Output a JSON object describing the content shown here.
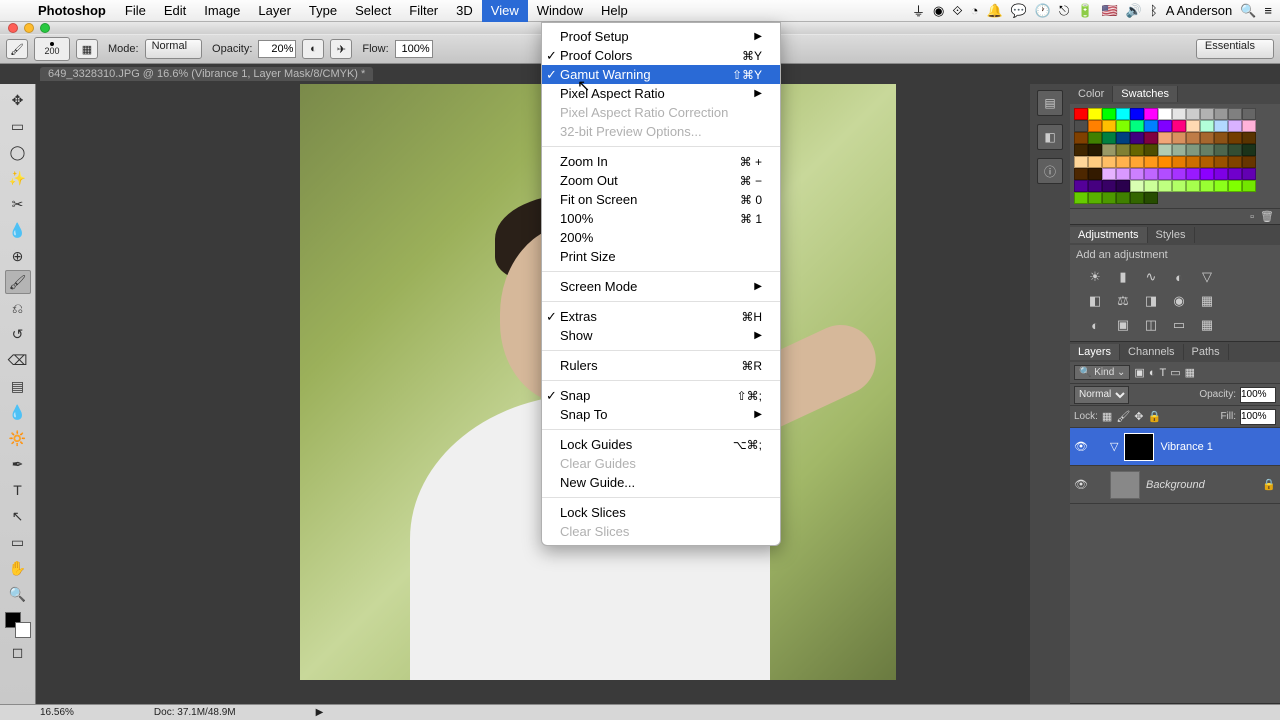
{
  "menubar": {
    "app": "Photoshop",
    "items": [
      "File",
      "Edit",
      "Image",
      "Layer",
      "Type",
      "Select",
      "Filter",
      "3D",
      "View",
      "Window",
      "Help"
    ],
    "active": "View",
    "user": "A Anderson"
  },
  "options": {
    "brush_size": "200",
    "mode_label": "Mode:",
    "mode_value": "Normal",
    "opacity_label": "Opacity:",
    "opacity_value": "20%",
    "flow_label": "Flow:",
    "flow_value": "100%",
    "workspace": "Essentials"
  },
  "document": {
    "tab_title": "649_3328310.JPG @ 16.6% (Vibrance 1, Layer Mask/8/CMYK) *"
  },
  "dropdown": {
    "items": [
      {
        "label": "Proof Setup",
        "submenu": true
      },
      {
        "label": "Proof Colors",
        "check": true,
        "shortcut": "⌘Y"
      },
      {
        "label": "Gamut Warning",
        "check": true,
        "shortcut": "⇧⌘Y",
        "highlight": true
      },
      {
        "label": "Pixel Aspect Ratio",
        "submenu": true
      },
      {
        "label": "Pixel Aspect Ratio Correction",
        "disabled": true
      },
      {
        "label": "32-bit Preview Options...",
        "disabled": true
      },
      {
        "sep": true
      },
      {
        "label": "Zoom In",
        "shortcut": "⌘ +"
      },
      {
        "label": "Zoom Out",
        "shortcut": "⌘ −"
      },
      {
        "label": "Fit on Screen",
        "shortcut": "⌘ 0"
      },
      {
        "label": "100%",
        "shortcut": "⌘ 1"
      },
      {
        "label": "200%"
      },
      {
        "label": "Print Size"
      },
      {
        "sep": true
      },
      {
        "label": "Screen Mode",
        "submenu": true
      },
      {
        "sep": true
      },
      {
        "label": "Extras",
        "check": true,
        "shortcut": "⌘H"
      },
      {
        "label": "Show",
        "submenu": true
      },
      {
        "sep": true
      },
      {
        "label": "Rulers",
        "shortcut": "⌘R"
      },
      {
        "sep": true
      },
      {
        "label": "Snap",
        "check": true,
        "shortcut": "⇧⌘;"
      },
      {
        "label": "Snap To",
        "submenu": true
      },
      {
        "sep": true
      },
      {
        "label": "Lock Guides",
        "shortcut": "⌥⌘;"
      },
      {
        "label": "Clear Guides",
        "disabled": true
      },
      {
        "label": "New Guide..."
      },
      {
        "sep": true
      },
      {
        "label": "Lock Slices"
      },
      {
        "label": "Clear Slices",
        "disabled": true
      }
    ]
  },
  "panels": {
    "color_tab": "Color",
    "swatches_tab": "Swatches",
    "adjustments_tab": "Adjustments",
    "styles_tab": "Styles",
    "add_adjustment": "Add an adjustment",
    "layers_tab": "Layers",
    "channels_tab": "Channels",
    "paths_tab": "Paths",
    "kind_label": "Kind",
    "blend_mode": "Normal",
    "opacity_label": "Opacity:",
    "opacity_value": "100%",
    "lock_label": "Lock:",
    "fill_label": "Fill:",
    "fill_value": "100%",
    "layer1_name": "Vibrance 1",
    "layer2_name": "Background"
  },
  "status": {
    "zoom": "16.56%",
    "doc": "Doc: 37.1M/48.9M"
  },
  "swatch_colors": [
    "#ff0000",
    "#ffff00",
    "#00ff00",
    "#00ffff",
    "#0000ff",
    "#ff00ff",
    "#ffffff",
    "#e5e5e5",
    "#cccccc",
    "#b2b2b2",
    "#999999",
    "#808080",
    "#666666",
    "#4d4d4d",
    "#ff8000",
    "#ffbf00",
    "#80ff00",
    "#00ff80",
    "#0080ff",
    "#8000ff",
    "#ff0080",
    "#ffd9b2",
    "#b2ffd9",
    "#b2d9ff",
    "#d9b2ff",
    "#ffb2d9",
    "#804000",
    "#408000",
    "#008040",
    "#004080",
    "#400080",
    "#800040",
    "#f2a678",
    "#d9915f",
    "#bf7c47",
    "#a6672e",
    "#8c5216",
    "#733d00",
    "#593300",
    "#402600",
    "#261a00",
    "#999966",
    "#808033",
    "#666600",
    "#4d4d00",
    "#b2ccb2",
    "#99b299",
    "#809980",
    "#668066",
    "#4d664d",
    "#334d33",
    "#1a331a",
    "#ffd699",
    "#ffcc80",
    "#ffbf66",
    "#ffb24d",
    "#ffa633",
    "#ff991a",
    "#ff8c00",
    "#e67c00",
    "#cc6e00",
    "#b25f00",
    "#995100",
    "#804300",
    "#663500",
    "#4d2700",
    "#331a00",
    "#e6b2ff",
    "#d999ff",
    "#cc80ff",
    "#bf66ff",
    "#b24dff",
    "#a633ff",
    "#991aff",
    "#8c00ff",
    "#7e00e6",
    "#7000cc",
    "#6200b2",
    "#540099",
    "#460080",
    "#380066",
    "#2a004d",
    "#d9ffb2",
    "#ccff99",
    "#bfff80",
    "#b2ff66",
    "#a6ff4d",
    "#99ff33",
    "#8cff1a",
    "#80ff00",
    "#73e600",
    "#66cc00",
    "#59b200",
    "#4d9900",
    "#408000",
    "#336600",
    "#264d00"
  ]
}
